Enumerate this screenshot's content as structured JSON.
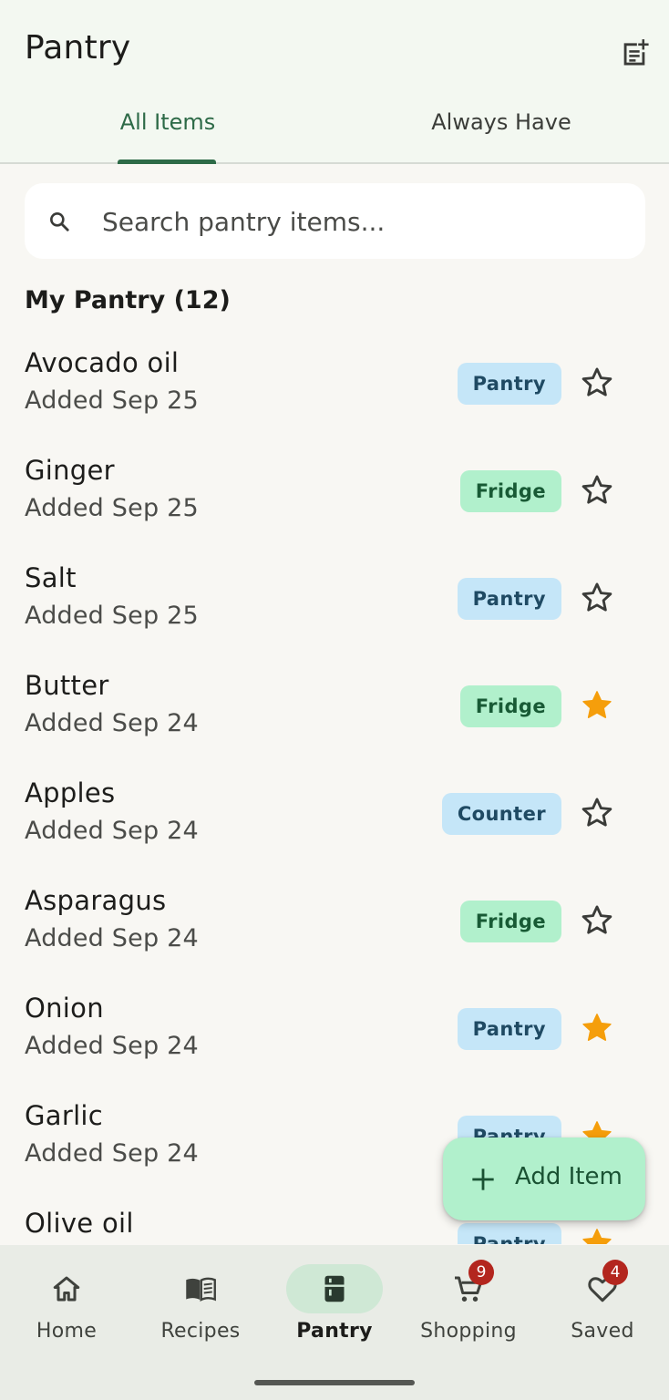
{
  "header": {
    "title": "Pantry",
    "action_icon": "note-add-icon"
  },
  "tabs": [
    {
      "label": "All Items",
      "selected": true
    },
    {
      "label": "Always Have",
      "selected": false
    }
  ],
  "search": {
    "placeholder": "Search pantry items...",
    "value": "",
    "icon": "search-icon"
  },
  "section": {
    "title": "My Pantry (12)"
  },
  "items": [
    {
      "name": "Avocado oil",
      "added": "Added Sep 25",
      "location": "Pantry",
      "favorite": false
    },
    {
      "name": "Ginger",
      "added": "Added Sep 25",
      "location": "Fridge",
      "favorite": false
    },
    {
      "name": "Salt",
      "added": "Added Sep 25",
      "location": "Pantry",
      "favorite": false
    },
    {
      "name": "Butter",
      "added": "Added Sep 24",
      "location": "Fridge",
      "favorite": true
    },
    {
      "name": "Apples",
      "added": "Added Sep 24",
      "location": "Counter",
      "favorite": false
    },
    {
      "name": "Asparagus",
      "added": "Added Sep 24",
      "location": "Fridge",
      "favorite": false
    },
    {
      "name": "Onion",
      "added": "Added Sep 24",
      "location": "Pantry",
      "favorite": true
    },
    {
      "name": "Garlic",
      "added": "Added Sep 24",
      "location": "Pantry",
      "favorite": true
    },
    {
      "name": "Olive oil",
      "added": "",
      "location": "Pantry",
      "favorite": true
    }
  ],
  "fab": {
    "label": "Add Item",
    "icon": "plus-icon"
  },
  "bottom_nav": [
    {
      "label": "Home",
      "icon": "home-icon",
      "badge": null,
      "active": false
    },
    {
      "label": "Recipes",
      "icon": "book-icon",
      "badge": null,
      "active": false
    },
    {
      "label": "Pantry",
      "icon": "kitchen-icon",
      "badge": null,
      "active": true
    },
    {
      "label": "Shopping",
      "icon": "cart-icon",
      "badge": "9",
      "active": false
    },
    {
      "label": "Saved",
      "icon": "heart-icon",
      "badge": "4",
      "active": false
    }
  ],
  "colors": {
    "accent": "#2d6a47",
    "star_filled": "#f59e0b",
    "star_outline": "#3a3b38",
    "pantry_badge_bg": "#c5e6f8",
    "fridge_badge_bg": "#b1f0cc",
    "nav_badge": "#b3261e"
  }
}
